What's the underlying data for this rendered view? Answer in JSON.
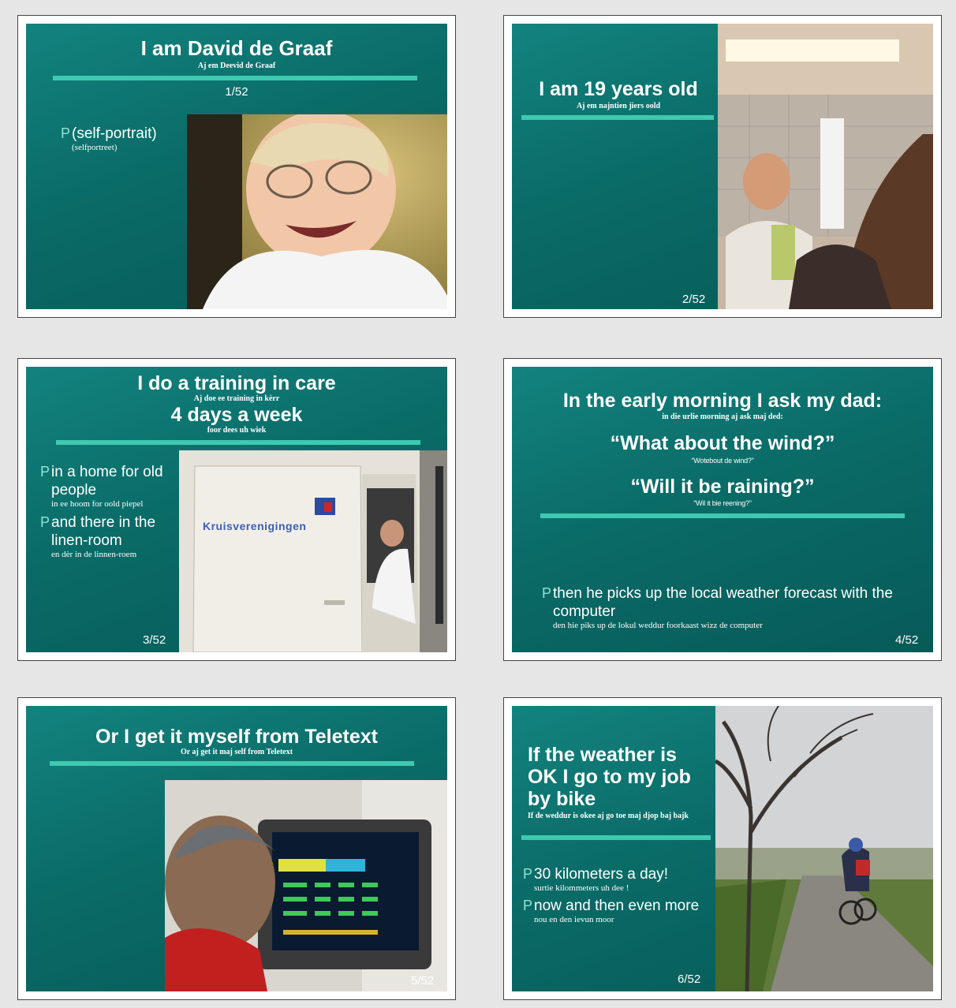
{
  "bullet_marker": "P",
  "slides": [
    {
      "title": "I am David de Graaf",
      "subtitle": "Aj em Deevid de Graaf",
      "page": "1/52",
      "bullets": [
        {
          "text": "(self-portrait)",
          "small": "(selfportreet)"
        }
      ]
    },
    {
      "title": "I am 19 years old",
      "subtitle": "Aj em najntien jiers oold",
      "page": "2/52"
    },
    {
      "title_line1": "I do a training in care",
      "subtitle_line1": "Aj doe ee training in kèrr",
      "title_line2": "4 days a week",
      "subtitle_line2": "foor dees uh wiek",
      "page": "3/52",
      "bullets": [
        {
          "text": "in a home for old people",
          "small": "in ee hoom for oold piepel"
        },
        {
          "text": "and there in the linen-room",
          "small": "en dèr in de linnen-roem"
        }
      ],
      "van_sign": "Kruisverenigingen"
    },
    {
      "title": "In the early morning I ask my dad:",
      "subtitle": "in die urlie morning aj ask maj ded:",
      "quote1": "“What about the wind?”",
      "quote1_small": "“Wotebout de wind?”",
      "quote2": "“Will it be raining?”",
      "quote2_small": "“Wil it bie reening?”",
      "page": "4/52",
      "bullets": [
        {
          "text": "then he picks up the local weather forecast with the computer",
          "small": "den hie piks up de lokul weddur foorkaast wizz de computer"
        }
      ]
    },
    {
      "title": "Or I get it myself from Teletext",
      "subtitle": "Or aj get it maj self from Teletext",
      "page": "5/52"
    },
    {
      "title": "If the weather is OK I go to my job by bike",
      "subtitle": "If de weddur is okee aj go toe maj djop baj bajk",
      "page": "6/52",
      "bullets": [
        {
          "text": "30 kilometers a day!",
          "small": "surtie kilommeters uh dee !"
        },
        {
          "text": "now and then even more",
          "small": "nou en den ievun moor"
        }
      ]
    }
  ]
}
